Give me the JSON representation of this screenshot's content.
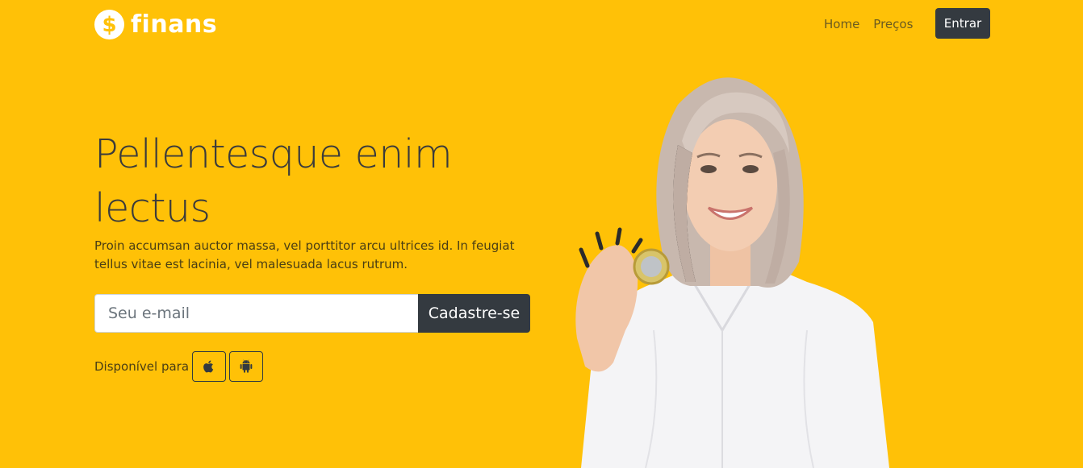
{
  "brand": {
    "name": "finans",
    "logo_icon": "dollar-coin-icon",
    "logo_symbol": "$"
  },
  "nav": {
    "links": [
      {
        "label": "Home"
      },
      {
        "label": "Preços"
      }
    ],
    "login_label": "Entrar"
  },
  "hero": {
    "title": "Pellentesque enim lectus",
    "text": "Proin accumsan auctor massa, vel porttitor arcu ultrices id. In feugiat tellus vitae est lacinia, vel malesuada lacus rutrum.",
    "email_placeholder": "Seu e-mail",
    "signup_label": "Cadastre-se",
    "available_label": "Disponível para",
    "platforms": [
      {
        "icon": "apple-icon"
      },
      {
        "icon": "android-icon"
      }
    ]
  },
  "colors": {
    "background": "#ffc107",
    "dark": "#343a40",
    "white": "#ffffff"
  }
}
